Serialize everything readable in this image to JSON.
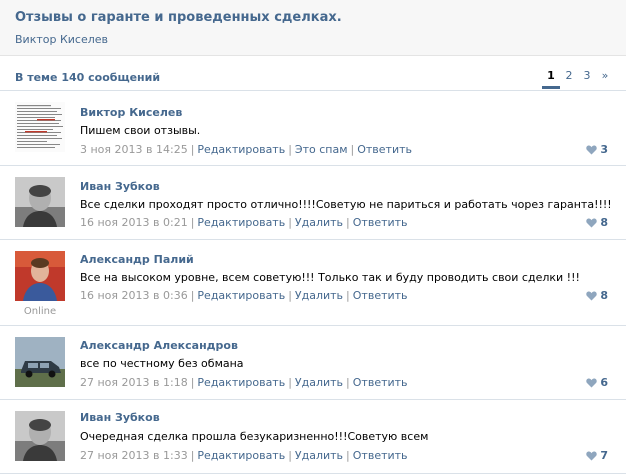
{
  "topic": {
    "title": "Отзывы о гаранте и проведенных сделках.",
    "author": "Виктор Киселев"
  },
  "thread": {
    "count_text": "В теме 140 сообщений",
    "pages": [
      "1",
      "2",
      "3",
      "»"
    ],
    "active_page": "1"
  },
  "colors": {
    "link": "#45688e",
    "muted": "#999999",
    "border": "#dae1e8"
  },
  "posts": [
    {
      "author": "Виктор Киселев",
      "text": "Пишем свои отзывы.",
      "date": "3 ноя 2013 в 14:25",
      "actions": [
        "Редактировать",
        "Это спам",
        "Ответить"
      ],
      "likes": "3",
      "avatar_icon": "document-thumbnail"
    },
    {
      "author": "Иван Зубков",
      "text": "Все сделки проходят просто отлично!!!!Советую не париться и работать чорез гаранта!!!!",
      "date": "16 ноя 2013 в 0:21",
      "actions": [
        "Редактировать",
        "Удалить",
        "Ответить"
      ],
      "likes": "8",
      "avatar_icon": "user-photo"
    },
    {
      "author": "Александр Палий",
      "text": "Все на высоком уровне, всем советую!!! Только так и буду проводить свои сделки !!!",
      "date": "16 ноя 2013 в 0:36",
      "actions": [
        "Редактировать",
        "Удалить",
        "Ответить"
      ],
      "likes": "8",
      "online": "Online",
      "avatar_icon": "user-photo"
    },
    {
      "author": "Александр Александров",
      "text": "все по честному без обмана",
      "date": "27 ноя 2013 в 1:18",
      "actions": [
        "Редактировать",
        "Удалить",
        "Ответить"
      ],
      "likes": "6",
      "avatar_icon": "car-photo"
    },
    {
      "author": "Иван Зубков",
      "text": "Очередная сделка прошла безукаризненно!!!Советую всем",
      "date": "27 ноя 2013 в 1:33",
      "actions": [
        "Редактировать",
        "Удалить",
        "Ответить"
      ],
      "likes": "7",
      "avatar_icon": "user-photo"
    }
  ]
}
